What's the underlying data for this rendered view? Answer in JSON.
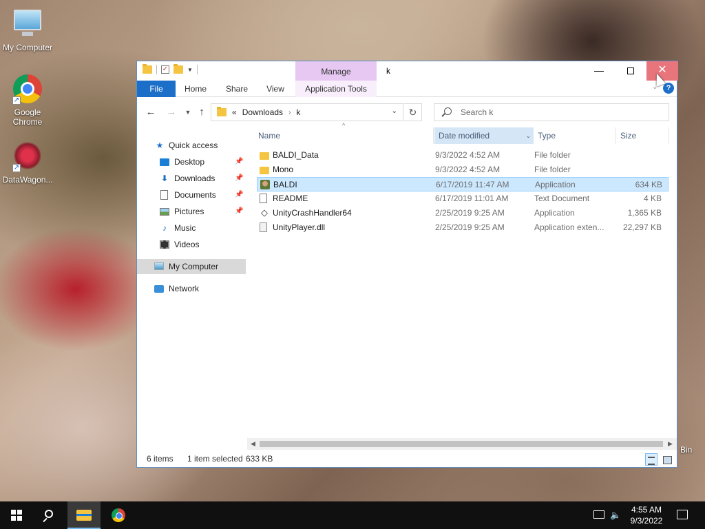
{
  "desktop": {
    "icons": [
      {
        "label": "My Computer"
      },
      {
        "label": "Google Chrome"
      },
      {
        "label": "DataWagon..."
      },
      {
        "label": "Bin"
      }
    ]
  },
  "window": {
    "title": "k",
    "manage_tab": "Manage",
    "ribbon_tabs": [
      "File",
      "Home",
      "Share",
      "View",
      "Application Tools"
    ],
    "address": {
      "overflow": "«",
      "crumbs": [
        "Downloads",
        "k"
      ]
    },
    "search_placeholder": "Search k",
    "nav": [
      {
        "label": "Quick access"
      },
      {
        "label": "Desktop",
        "pinned": true
      },
      {
        "label": "Downloads",
        "pinned": true
      },
      {
        "label": "Documents",
        "pinned": true
      },
      {
        "label": "Pictures",
        "pinned": true
      },
      {
        "label": "Music"
      },
      {
        "label": "Videos"
      },
      {
        "label": "My Computer",
        "selected": true
      },
      {
        "label": "Network"
      }
    ],
    "columns": {
      "name": "Name",
      "date": "Date modified",
      "type": "Type",
      "size": "Size"
    },
    "files": [
      {
        "name": "BALDI_Data",
        "date": "9/3/2022 4:52 AM",
        "type": "File folder",
        "size": "",
        "icon": "folder-icon"
      },
      {
        "name": "Mono",
        "date": "9/3/2022 4:52 AM",
        "type": "File folder",
        "size": "",
        "icon": "folder-icon"
      },
      {
        "name": "BALDI",
        "date": "6/17/2019 11:47 AM",
        "type": "Application",
        "size": "634 KB",
        "icon": "application-icon",
        "selected": true
      },
      {
        "name": "README",
        "date": "6/17/2019 11:01 AM",
        "type": "Text Document",
        "size": "4 KB",
        "icon": "text-document-icon"
      },
      {
        "name": "UnityCrashHandler64",
        "date": "2/25/2019 9:25 AM",
        "type": "Application",
        "size": "1,365 KB",
        "icon": "unity-icon"
      },
      {
        "name": "UnityPlayer.dll",
        "date": "2/25/2019 9:25 AM",
        "type": "Application exten...",
        "size": "22,297 KB",
        "icon": "dll-icon"
      }
    ],
    "status": {
      "items": "6 items",
      "selected": "1 item selected",
      "size": "633 KB"
    }
  },
  "taskbar": {
    "time": "4:55 AM",
    "date": "9/3/2022"
  },
  "colors": {
    "accent": "#1c6fc9",
    "manage_tab": "#e6c8f2",
    "close_hover": "#e8747c",
    "selection": "#cce8ff"
  }
}
